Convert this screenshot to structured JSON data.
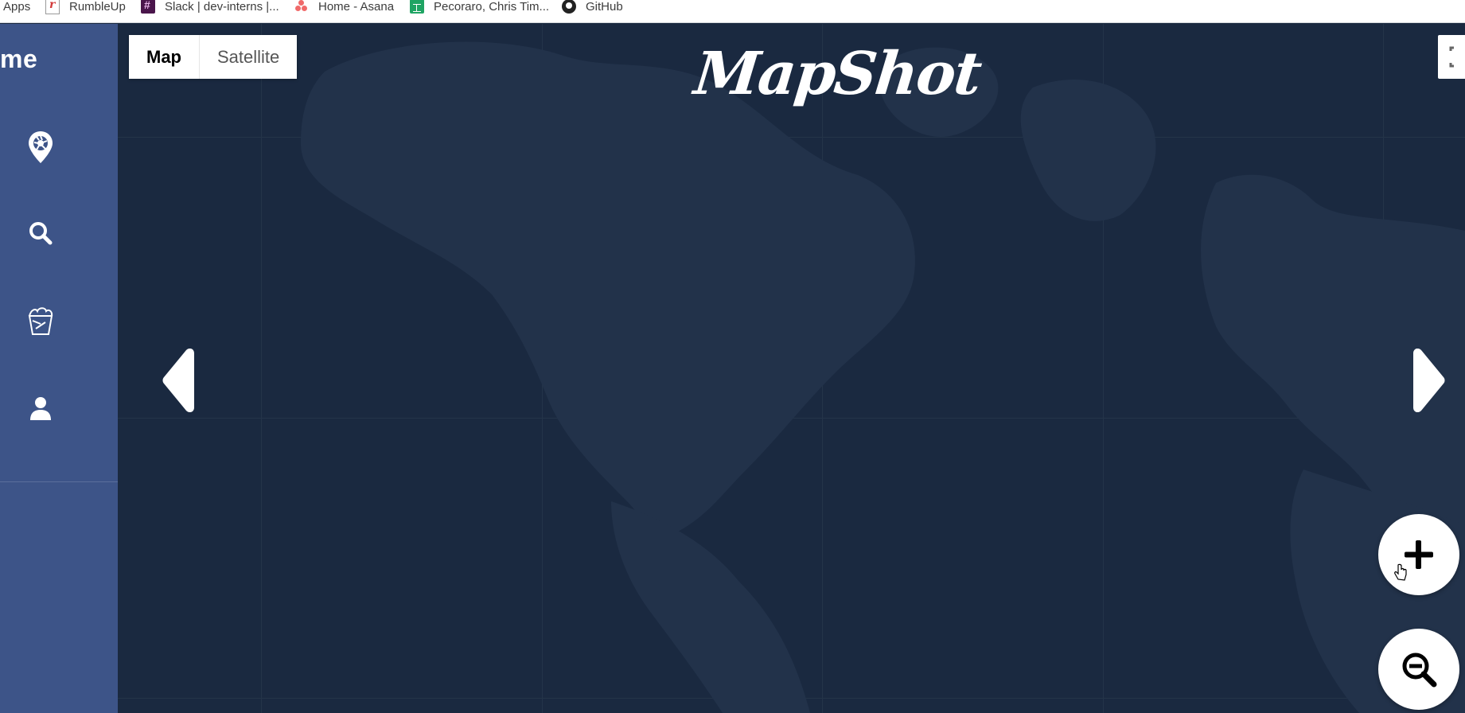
{
  "bookmarks": [
    {
      "label": "Apps",
      "icon": "apps-icon"
    },
    {
      "label": "RumbleUp",
      "icon": "rumbleup-icon"
    },
    {
      "label": "Slack | dev-interns |...",
      "icon": "slack-icon"
    },
    {
      "label": "Home - Asana",
      "icon": "asana-icon"
    },
    {
      "label": "Pecoraro, Chris Tim...",
      "icon": "google-sheets-icon"
    },
    {
      "label": "GitHub",
      "icon": "github-icon"
    }
  ],
  "sidebar": {
    "title": "me",
    "items": [
      {
        "name": "map-pin-camera-icon"
      },
      {
        "name": "search-icon"
      },
      {
        "name": "bucket-icon"
      },
      {
        "name": "user-icon"
      }
    ],
    "bg_color": "#3d5488"
  },
  "map": {
    "type_controls": {
      "map_label": "Map",
      "satellite_label": "Satellite",
      "selected": "Map"
    },
    "brand": "MapShot",
    "bg_color": "#1a2940"
  },
  "controls": {
    "prev": "chevron-left-icon",
    "next": "chevron-right-icon",
    "zoom_in": "plus-icon",
    "zoom_out": "zoom-out-icon"
  }
}
